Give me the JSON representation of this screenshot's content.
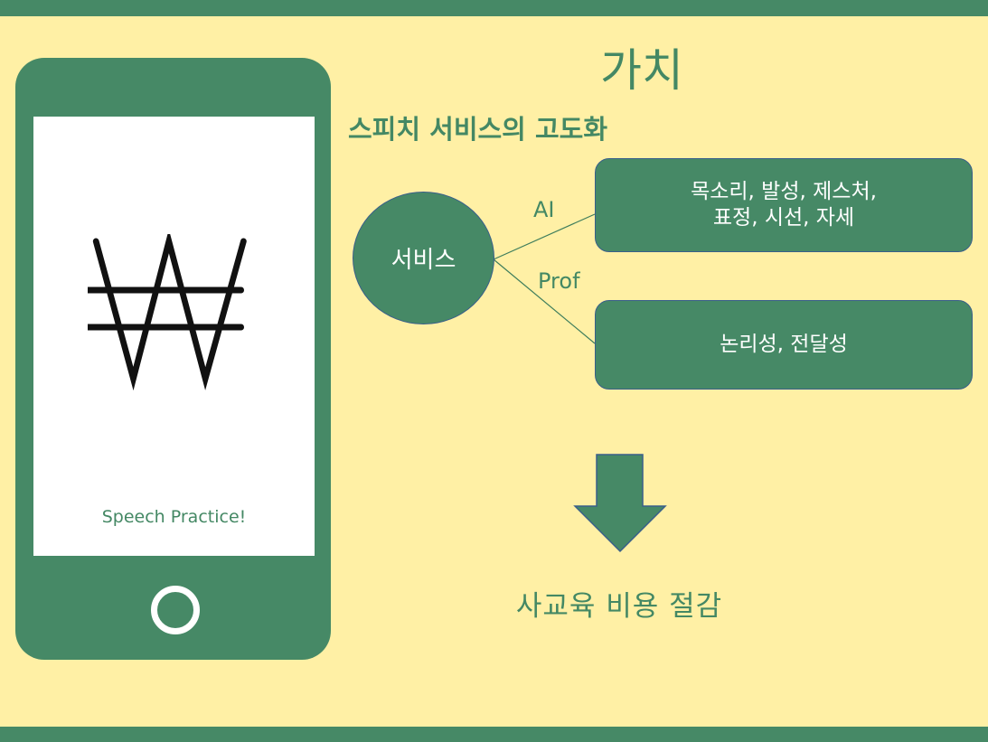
{
  "colors": {
    "background": "#fff0a5",
    "green": "#468966",
    "green_text": "#448864",
    "white": "#ffffff"
  },
  "slide": {
    "title": "가치",
    "subtitle": "스피치 서비스의 고도화"
  },
  "phone": {
    "logo_icon": "won-sign-icon",
    "app_name": "Speech Practice!",
    "home_button_icon": "circle-ring-icon"
  },
  "diagram": {
    "center": "서비스",
    "branches": [
      {
        "edge_label": "AI",
        "box_lines": [
          "목소리, 발성, 제스처,",
          "표정, 시선, 자세"
        ]
      },
      {
        "edge_label": "Prof",
        "box_lines": [
          "논리성, 전달성"
        ]
      }
    ],
    "arrow_icon": "down-arrow-icon",
    "result": "사교육 비용 절감"
  }
}
